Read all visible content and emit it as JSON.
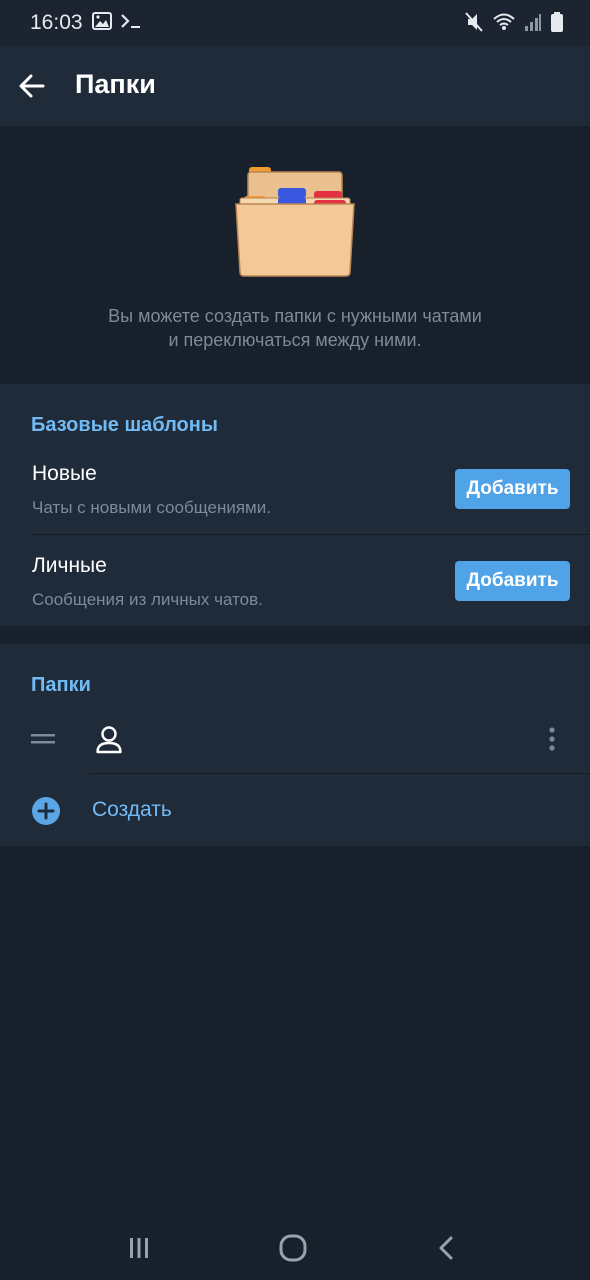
{
  "status_bar": {
    "time": "16:03",
    "left_icons": [
      "gallery-icon",
      "terminal-icon"
    ],
    "right_icons": [
      "mute-icon",
      "wifi-icon",
      "signal-icon",
      "battery-icon"
    ]
  },
  "app_bar": {
    "back_icon": "arrow-left-icon",
    "title": "Папки"
  },
  "hero": {
    "illustration": "file-cabinet-folder",
    "description_line1": "Вы можете создать папки с нужными чатами",
    "description_line2": "и переключаться между ними."
  },
  "templates": {
    "header": "Базовые шаблоны",
    "items": [
      {
        "title": "Новые",
        "subtitle": "Чаты с новыми сообщениями.",
        "button": "Добавить"
      },
      {
        "title": "Личные",
        "subtitle": "Сообщения из личных чатов.",
        "button": "Добавить"
      }
    ]
  },
  "folders": {
    "header": "Папки",
    "items": [
      {
        "icon": "user-icon",
        "name": ""
      }
    ],
    "create_label": "Создать"
  },
  "colors": {
    "background": "#17202b",
    "surface": "#202b3a",
    "accent": "#71baf3",
    "button": "#4fa3e6",
    "secondary_text": "#7d8a99"
  },
  "nav_bar": {
    "buttons": [
      "recent-apps-icon",
      "home-icon",
      "back-icon"
    ]
  }
}
